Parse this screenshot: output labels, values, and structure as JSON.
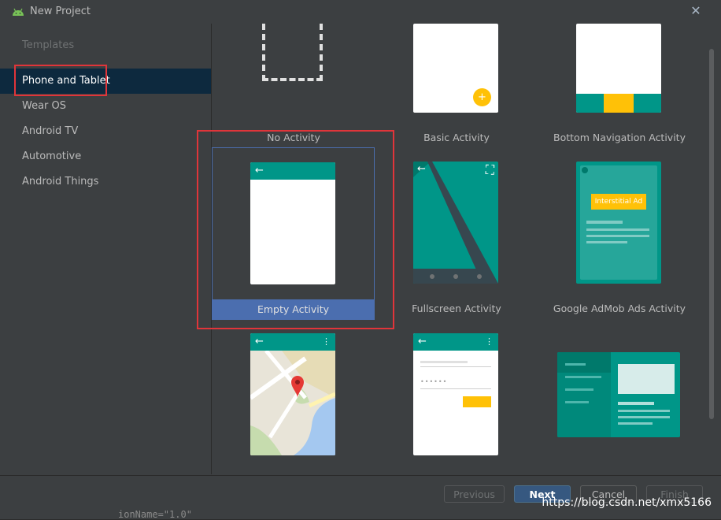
{
  "window": {
    "title": "New Project",
    "close_glyph": "✕"
  },
  "sidebar": {
    "header": "Templates",
    "items": [
      {
        "label": "Phone and Tablet"
      },
      {
        "label": "Wear OS"
      },
      {
        "label": "Android TV"
      },
      {
        "label": "Automotive"
      },
      {
        "label": "Android Things"
      }
    ]
  },
  "templates": {
    "row1": [
      "No Activity",
      "Basic Activity",
      "Bottom Navigation Activity"
    ],
    "row2": [
      "Empty Activity",
      "Fullscreen Activity",
      "Google AdMob Ads Activity"
    ],
    "admob_ad_label": "Interstitial Ad",
    "fab_glyph": "+",
    "back_arrow": "←",
    "overflow_dots": "⋮",
    "fullscreen_glyph": "⛶",
    "password_mask": "••••••"
  },
  "footer": {
    "previous": "Previous",
    "next": "Next",
    "cancel": "Cancel",
    "finish": "Finish"
  },
  "watermark": "https://blog.csdn.net/xmx5166",
  "background_code": "ionName=\"1.0\"",
  "colors": {
    "teal": "#009688",
    "selection_blue": "#4b6eaf",
    "highlight_red": "#e0353a",
    "fab_yellow": "#ffc107"
  }
}
